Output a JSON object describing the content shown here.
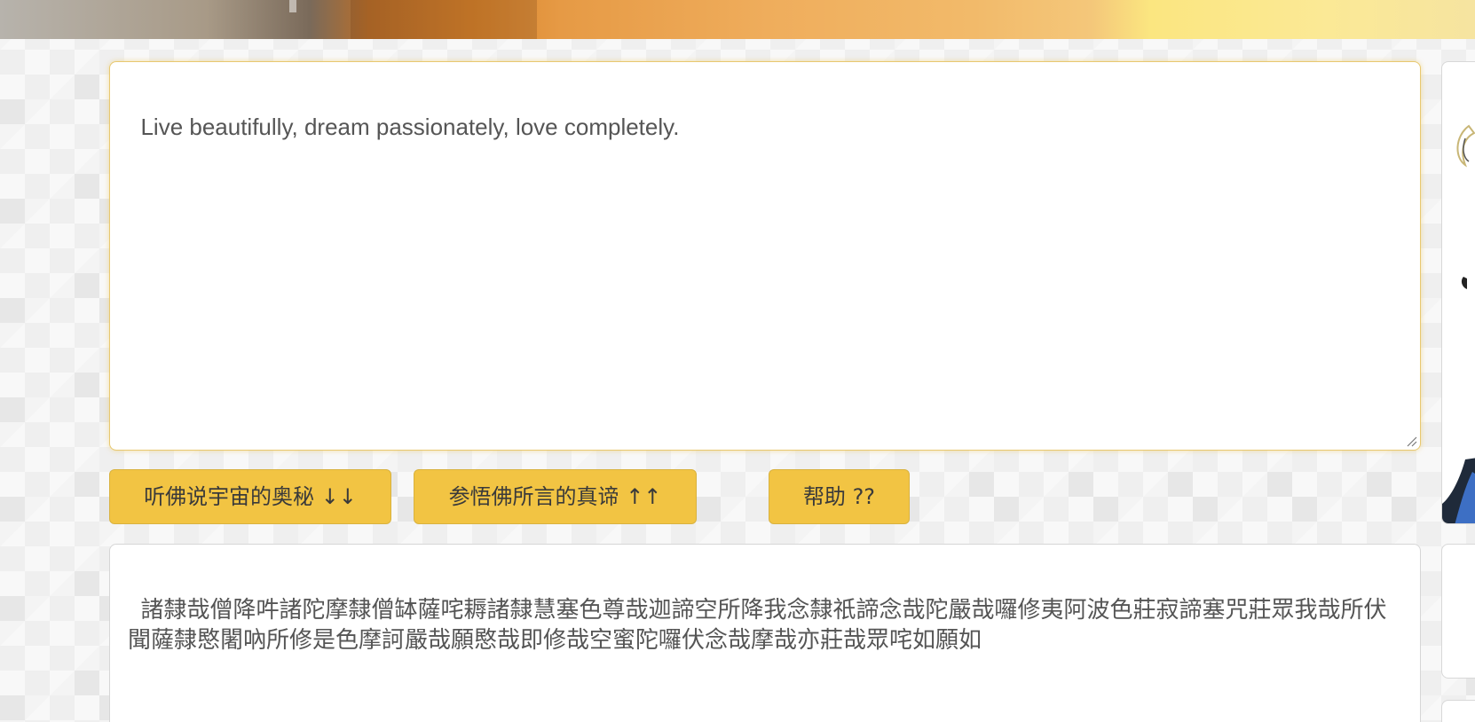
{
  "input": {
    "text": "Live beautifully, dream passionately, love completely."
  },
  "buttons": {
    "decode_label": "听佛说宇宙的奥秘 ↓↓",
    "encode_label": "参悟佛所言的真谛 ↑↑",
    "help_label": "帮助 ??"
  },
  "output": {
    "text": "諸隸哉僧降吽諸陀摩隸僧缽薩咤耨諸隸慧塞色尊哉迦諦空所降我念隸祇諦念哉陀嚴哉囉修夷阿波色莊寂諦塞咒莊眾我哉所伏聞薩隸愍闍吶所修是色摩訶嚴哉願愍哉即修哉空蜜陀囉伏念哉摩哉亦莊哉眾咤如願如"
  },
  "colors": {
    "button_bg": "#f2c443",
    "input_border": "#e8c870",
    "text": "#555555"
  },
  "icons": {
    "resize": "resize-grip-icon"
  }
}
